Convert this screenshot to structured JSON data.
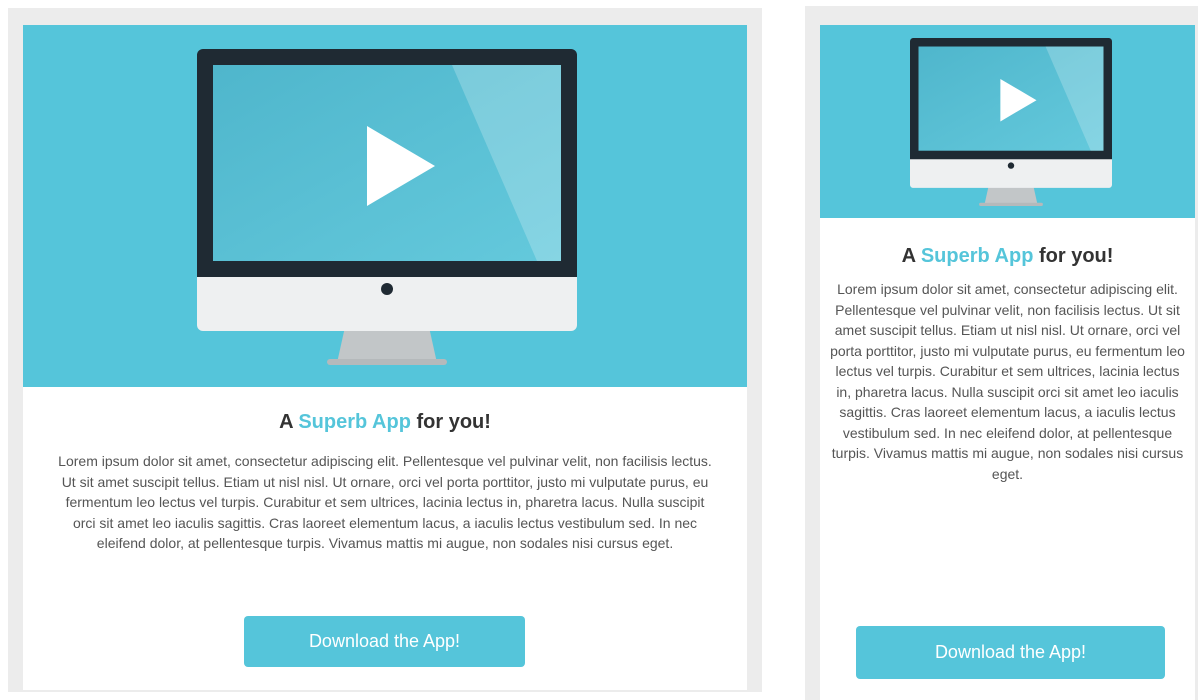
{
  "colors": {
    "accent": "#55c5da",
    "frame": "#ececec",
    "text_dark": "#333333",
    "text_body": "#555555",
    "button_text": "#ffffff"
  },
  "icons": {
    "hero": "monitor-play-icon"
  },
  "cards": [
    {
      "headline_prefix": "A ",
      "headline_accent": "Superb App",
      "headline_suffix": " for you!",
      "body": "Lorem ipsum dolor sit amet, consectetur adipiscing elit. Pellentesque vel pulvinar velit, non facilisis lectus. Ut sit amet suscipit tellus. Etiam ut nisl nisl. Ut ornare, orci vel porta porttitor, justo mi vulputate purus, eu fermentum leo lectus vel turpis. Curabitur et sem ultrices, lacinia lectus in, pharetra lacus. Nulla suscipit orci sit amet leo iaculis sagittis. Cras laoreet elementum lacus, a iaculis lectus vestibulum sed. In nec eleifend dolor, at pellentesque turpis. Vivamus mattis mi augue, non sodales nisi cursus eget.",
      "button_label": "Download the App!"
    },
    {
      "headline_prefix": "A ",
      "headline_accent": "Superb App",
      "headline_suffix": " for you!",
      "body": "Lorem ipsum dolor sit amet, consectetur adipiscing elit. Pellentesque vel pulvinar velit, non facilisis lectus. Ut sit amet suscipit tellus. Etiam ut nisl nisl. Ut ornare, orci vel porta porttitor, justo mi vulputate purus, eu fermentum leo lectus vel turpis. Curabitur et sem ultrices, lacinia lectus in, pharetra lacus. Nulla suscipit orci sit amet leo iaculis sagittis. Cras laoreet elementum lacus, a iaculis lectus vestibulum sed. In nec eleifend dolor, at pellentesque turpis. Vivamus mattis mi augue, non sodales nisi cursus eget.",
      "button_label": "Download the App!"
    }
  ]
}
